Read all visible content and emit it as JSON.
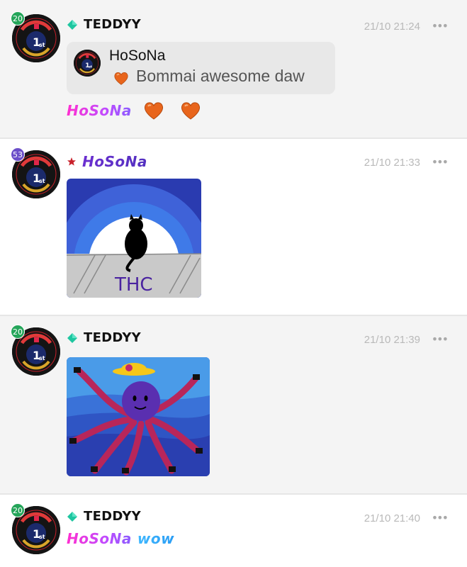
{
  "messages": [
    {
      "author": "TEDDYY",
      "level": "20",
      "time": "21/10 21:24",
      "more": "•••",
      "quote": {
        "author": "HoSoNa",
        "text": "Bommai awesome daw"
      },
      "text": "HoSoNa"
    },
    {
      "author": "HoSoNa",
      "level": "53",
      "time": "21/10 21:33",
      "more": "•••",
      "image_caption": "THC"
    },
    {
      "author": "TEDDYY",
      "level": "20",
      "time": "21/10 21:39",
      "more": "•••"
    },
    {
      "author": "TEDDYY",
      "level": "20",
      "time": "21/10 21:40",
      "more": "•••",
      "text_parts": [
        "HoSoNa",
        "wow"
      ]
    }
  ],
  "colors": {
    "gem": "#1ec6a0",
    "timestamp": "#b9b9b9",
    "level_green": "#25a55a",
    "level_purple": "#6b4ec9"
  },
  "icons": [
    "gem-icon",
    "star-icon",
    "heart-icon",
    "more-icon",
    "avatar-badge"
  ]
}
